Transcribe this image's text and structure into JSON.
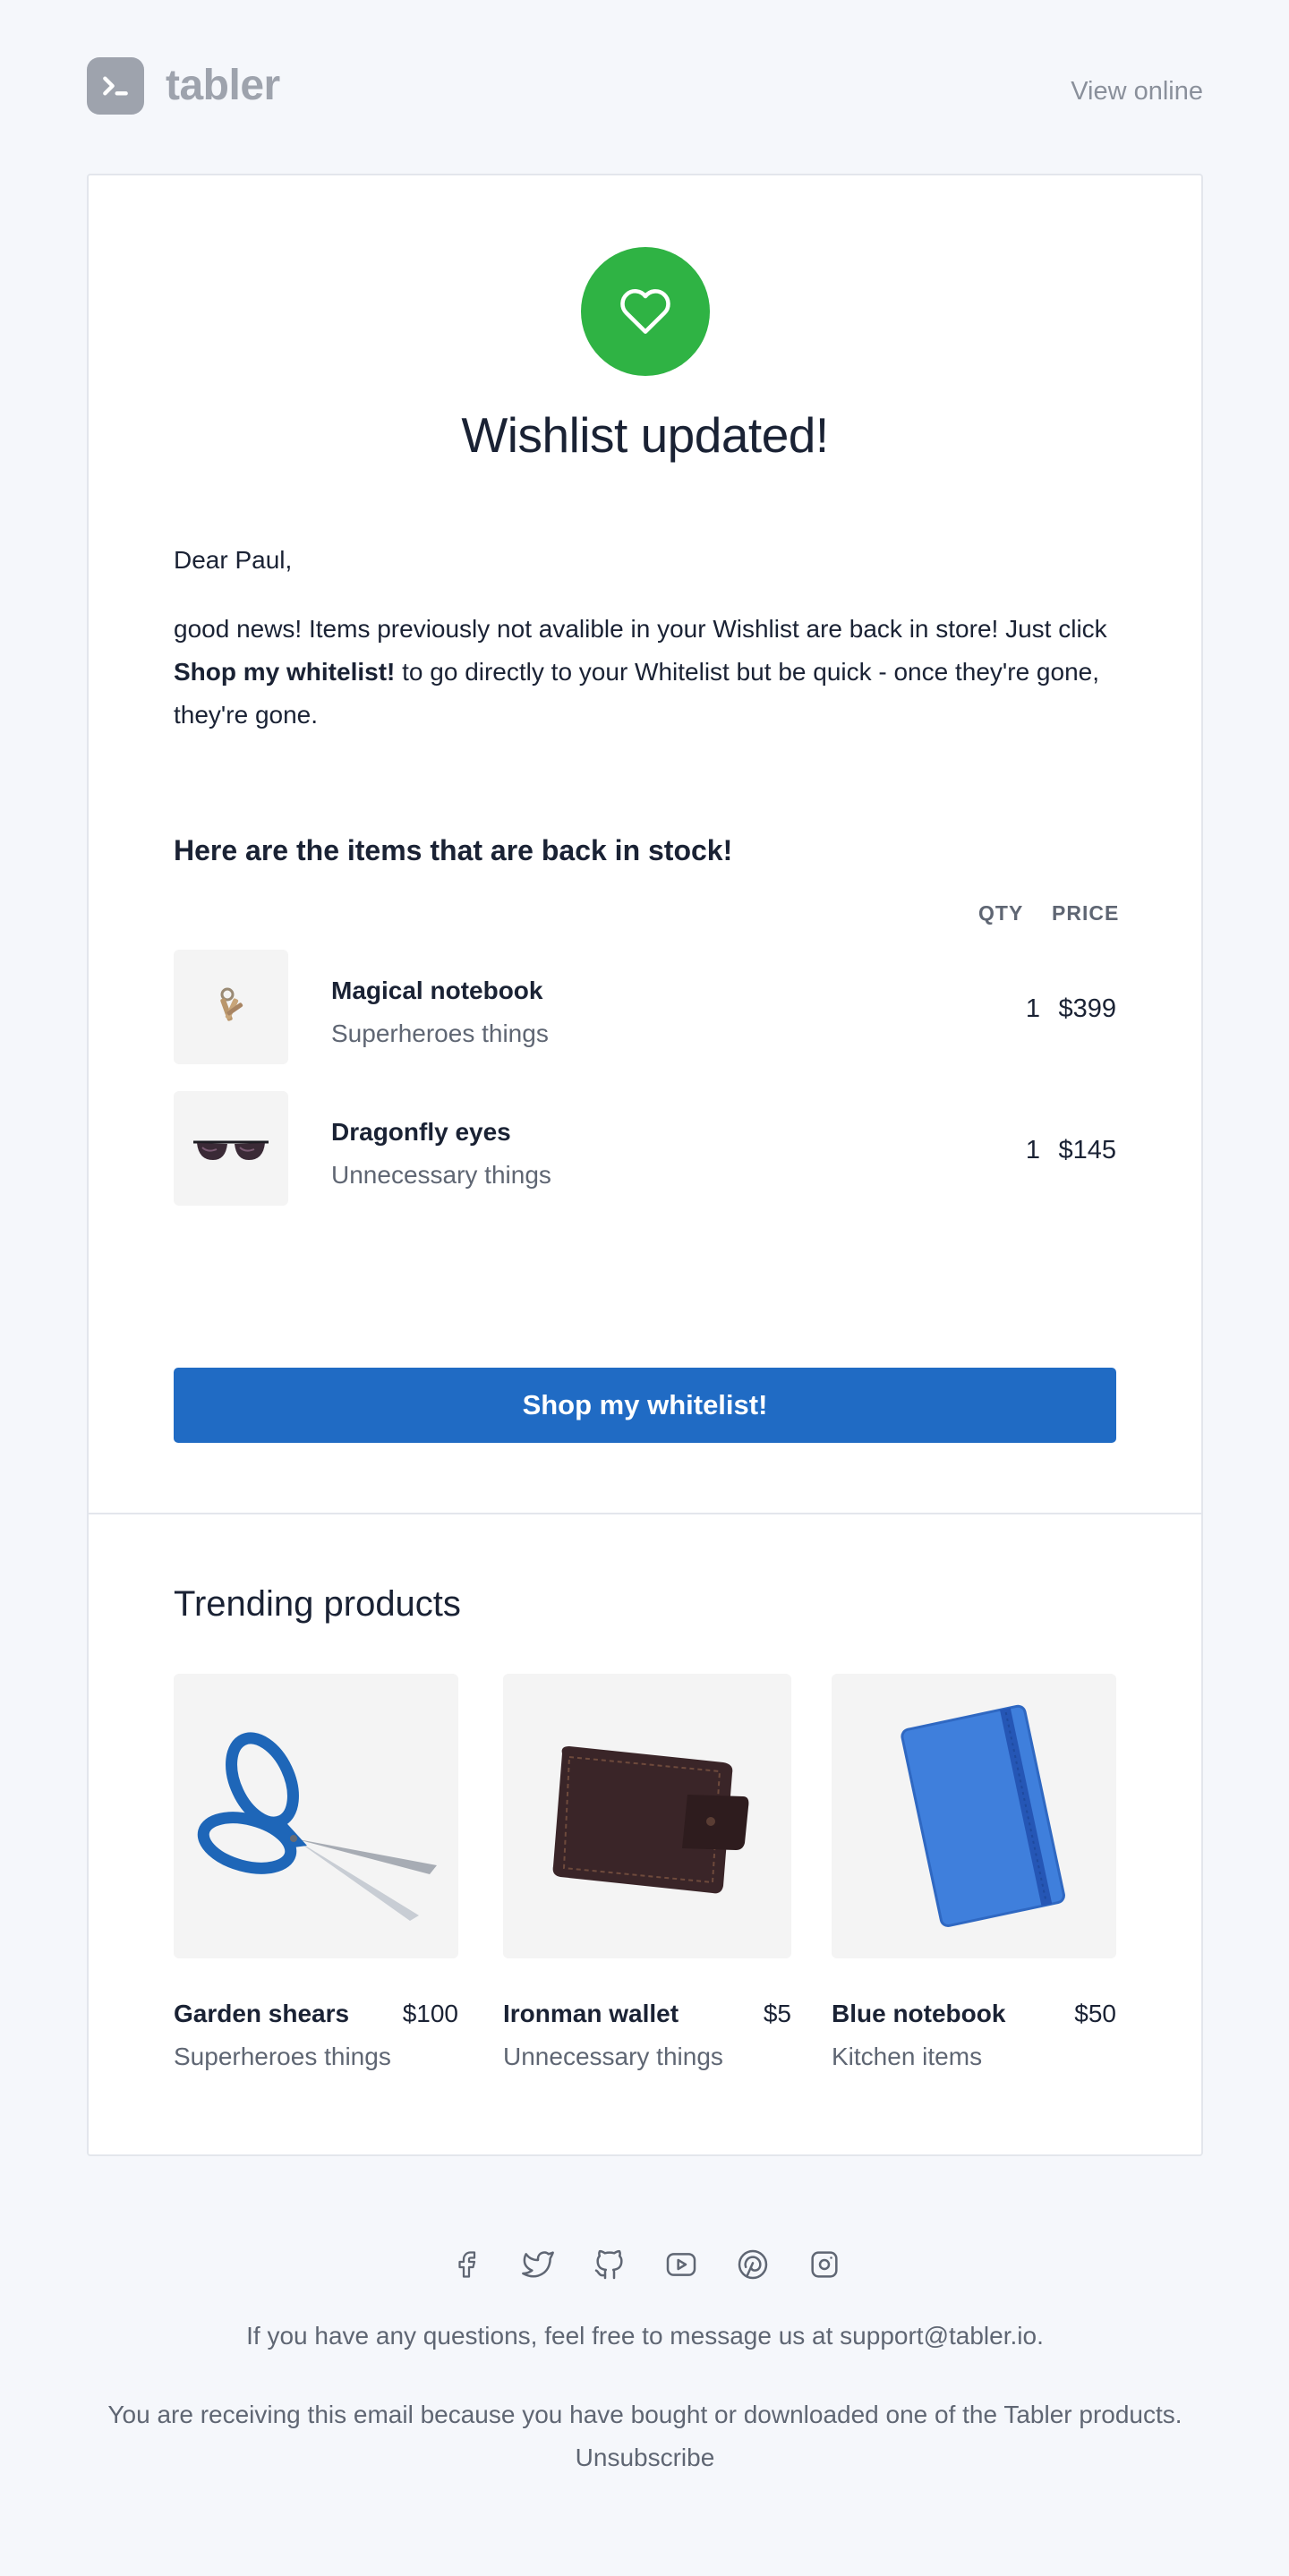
{
  "header": {
    "brand": "tabler",
    "view_online": "View online"
  },
  "hero": {
    "icon": "heart-icon",
    "accent": "#2fb344",
    "title": "Wishlist updated!"
  },
  "message": {
    "greeting": "Dear Paul,",
    "body_start": "good news! Items previously not avalible in your Wishlist are back in store! Just click ",
    "body_bold": "Shop my whitelist!",
    "body_end": " to go directly to your Whitelist but be quick - once they're gone, they're gone."
  },
  "stock": {
    "heading": "Here are the items that are back in stock!",
    "col_qty": "QTY",
    "col_price": "PRICE",
    "items": [
      {
        "name": "Magical notebook",
        "category": "Superheroes things",
        "qty": "1",
        "price": "$399",
        "image": "keys-image"
      },
      {
        "name": "Dragonfly eyes",
        "category": "Unnecessary things",
        "qty": "1",
        "price": "$145",
        "image": "sunglasses-image"
      }
    ]
  },
  "cta": {
    "label": "Shop my whitelist!",
    "color": "#206bc4"
  },
  "trending": {
    "heading": "Trending products",
    "products": [
      {
        "name": "Garden shears",
        "price": "$100",
        "category": "Superheroes things",
        "image": "scissors-image"
      },
      {
        "name": "Ironman wallet",
        "price": "$5",
        "category": "Unnecessary things",
        "image": "wallet-image"
      },
      {
        "name": "Blue notebook",
        "price": "$50",
        "category": "Kitchen items",
        "image": "notebook-image"
      }
    ]
  },
  "footer": {
    "social": [
      "facebook-icon",
      "twitter-icon",
      "github-icon",
      "youtube-icon",
      "pinterest-icon",
      "instagram-icon"
    ],
    "questions": "If you have any questions, feel free to message us at support@tabler.io.",
    "receiving": "You are receiving this email because you have bought or downloaded one of the Tabler products.",
    "unsubscribe": "Unsubscribe"
  }
}
